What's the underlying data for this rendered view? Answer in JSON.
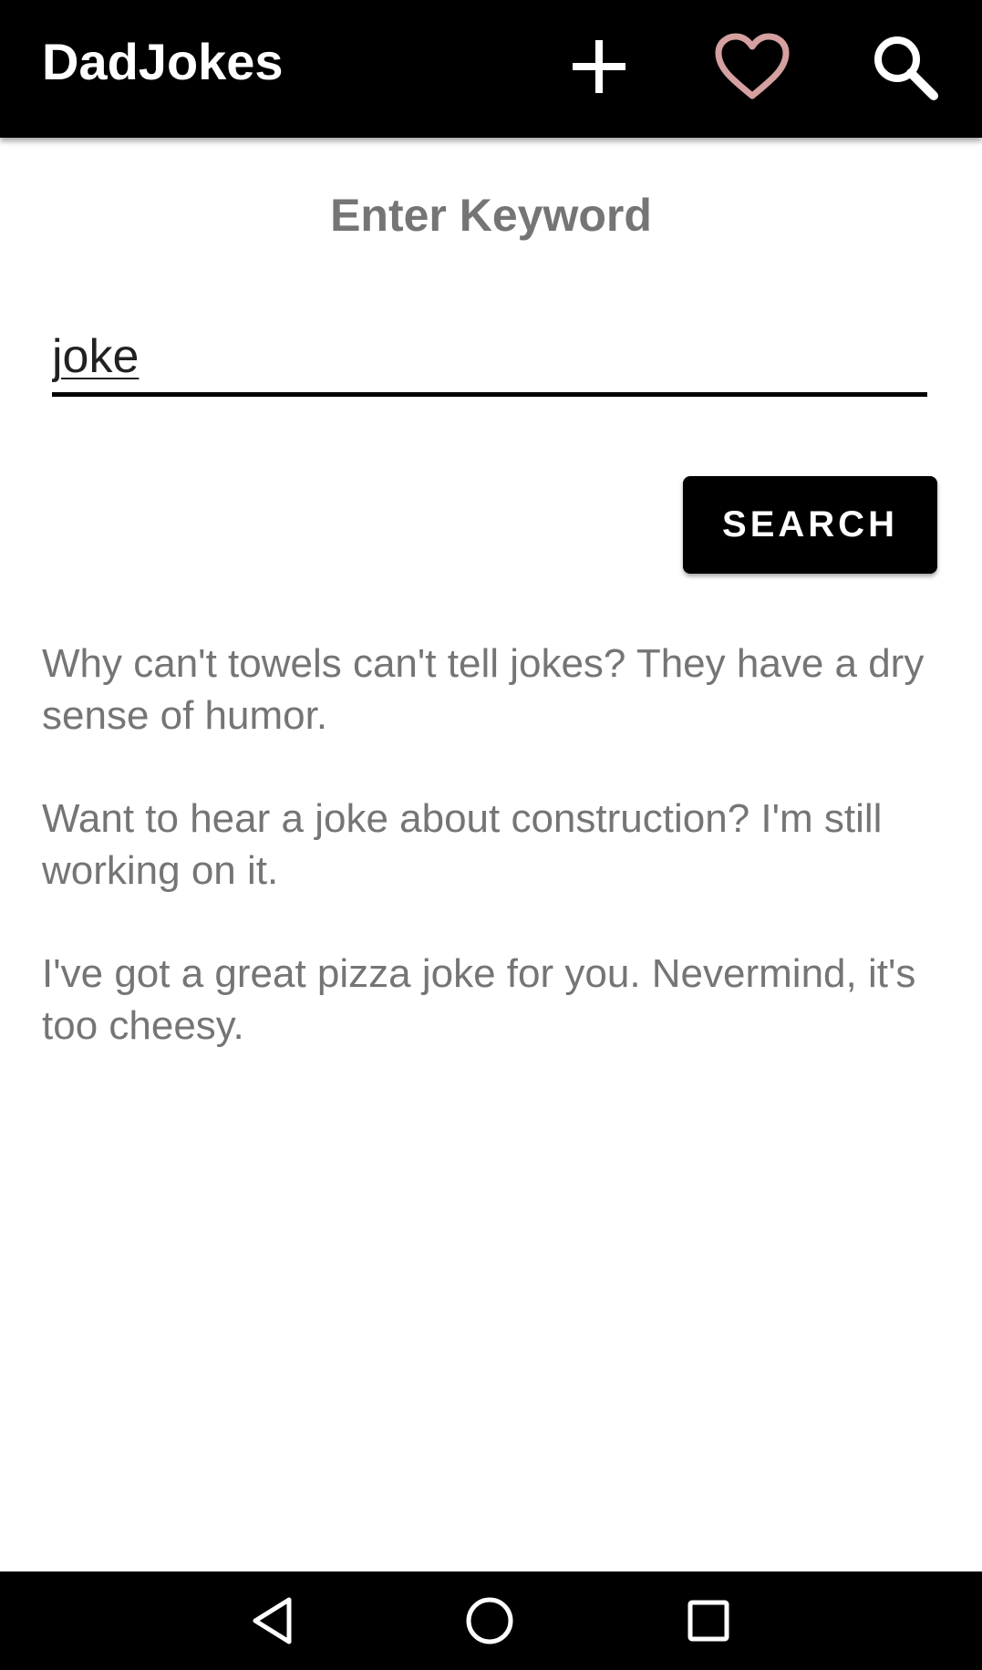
{
  "app_bar": {
    "title": "DadJokes",
    "icons": {
      "add": "plus-icon",
      "favorites": "heart-icon",
      "search": "search-icon"
    },
    "colors": {
      "background": "#000000",
      "title": "#ffffff",
      "heart": "#d4a0a0"
    }
  },
  "search_form": {
    "heading": "Enter Keyword",
    "keyword_value": "joke",
    "button_label": "SEARCH"
  },
  "jokes": [
    "Why can't towels can't tell jokes? They have a dry sense of humor.",
    "Want to hear a joke about construction? I'm still working on it.",
    "I've got a great pizza joke for you. Nevermind, it's too cheesy."
  ],
  "nav_bar": {
    "icons": {
      "back": "back-triangle-icon",
      "home": "home-circle-icon",
      "recents": "recents-square-icon"
    }
  }
}
